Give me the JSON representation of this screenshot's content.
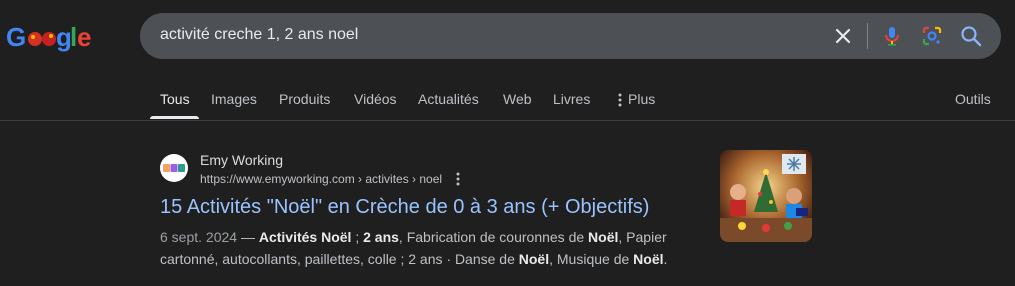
{
  "logo": {
    "alt_text": "Google"
  },
  "search": {
    "query": "activité creche 1, 2 ans noel",
    "clear_icon": "close-icon",
    "voice_icon": "mic-icon",
    "lens_icon": "lens-icon",
    "submit_icon": "search-icon"
  },
  "tabs": {
    "items": [
      {
        "label": "Tous",
        "active": true
      },
      {
        "label": "Images"
      },
      {
        "label": "Produits"
      },
      {
        "label": "Vidéos"
      },
      {
        "label": "Actualités"
      },
      {
        "label": "Web"
      },
      {
        "label": "Livres"
      },
      {
        "label": "Plus"
      }
    ],
    "tools": "Outils"
  },
  "result": {
    "site_name": "Emy Working",
    "url": "https://www.emyworking.com › activites › noel",
    "title": "15 Activités \"Noël\" en Crèche de 0 à 3 ans (+ Objectifs)",
    "snippet": {
      "date": "6 sept. 2024",
      "sep": " — ",
      "b1": "Activités Noël",
      "t1": " ; ",
      "b2": "2 ans",
      "t2": ", Fabrication de couronnes de ",
      "b3": "Noël",
      "t3": ", Papier cartonné, autocollants, paillettes, colle ; 2 ans · Danse de ",
      "b4": "Noël",
      "t4": ", Musique de ",
      "b5": "Noël",
      "t5": "."
    }
  },
  "colors": {
    "background": "#1f1f1f",
    "searchbar": "#4d5156",
    "link": "#99c3ff",
    "text": "#bdc1c6"
  }
}
